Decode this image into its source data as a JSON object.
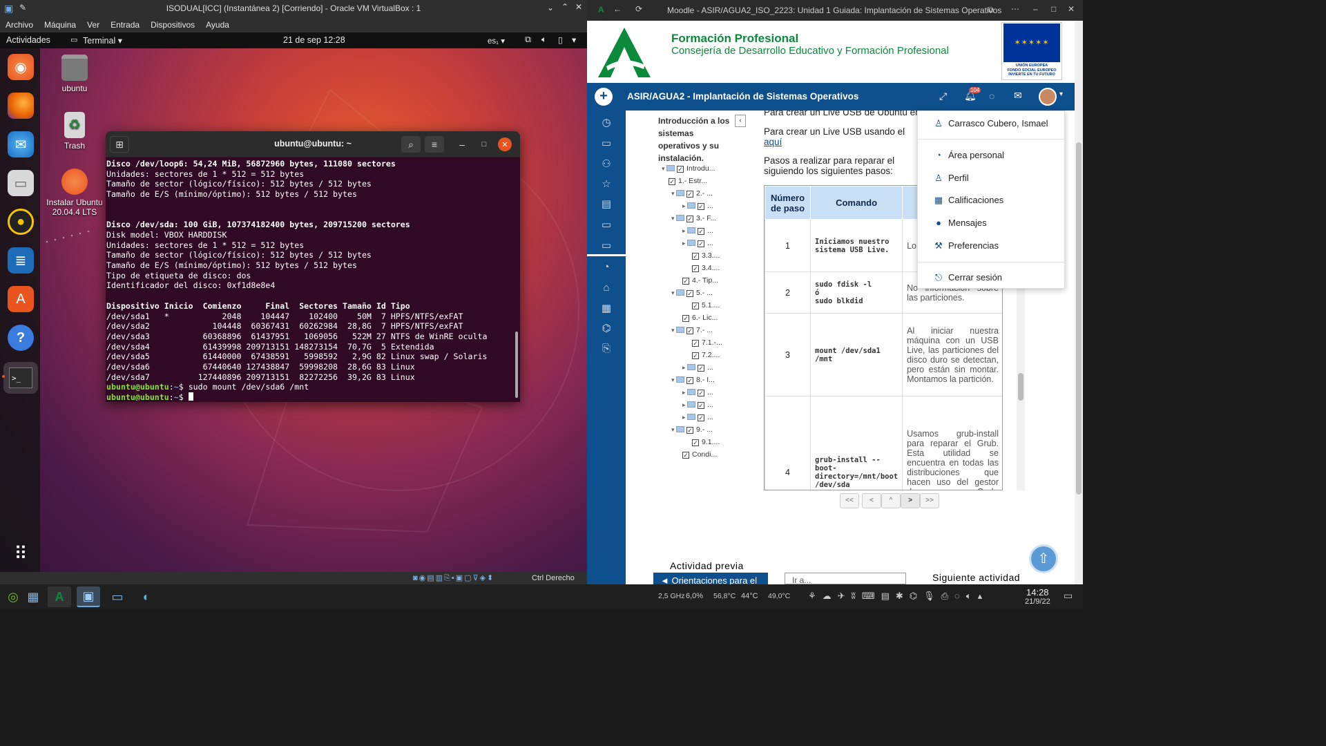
{
  "vbox": {
    "title": "ISODUAL[ICC] (Instantánea 2) [Corriendo] - Oracle VM VirtualBox : 1",
    "menu": [
      "Archivo",
      "Máquina",
      "Ver",
      "Entrada",
      "Dispositivos",
      "Ayuda"
    ],
    "status_key": "Ctrl Derecho"
  },
  "guest": {
    "activities": "Actividades",
    "app_menu": "Terminal ▾",
    "clock": "21 de sep  12:28",
    "keyboard": "es₁ ▾",
    "desktop_icons": [
      {
        "label": "ubuntu"
      },
      {
        "label": "Trash"
      },
      {
        "label": "Instalar Ubuntu 20.04.4 LTS"
      }
    ]
  },
  "terminal": {
    "title": "ubuntu@ubuntu: ~",
    "lines": [
      {
        "t": "Disco /dev/loop6: 54,24 MiB, 56872960 bytes, 111080 sectores",
        "c": "b"
      },
      {
        "t": "Unidades: sectores de 1 * 512 = 512 bytes",
        "c": ""
      },
      {
        "t": "Tamaño de sector (lógico/físico): 512 bytes / 512 bytes",
        "c": ""
      },
      {
        "t": "Tamaño de E/S (mínimo/óptimo): 512 bytes / 512 bytes",
        "c": ""
      },
      {
        "t": "",
        "c": ""
      },
      {
        "t": "",
        "c": ""
      },
      {
        "t": "Disco /dev/sda: 100 GiB, 107374182400 bytes, 209715200 sectores",
        "c": "b"
      },
      {
        "t": "Disk model: VBOX HARDDISK",
        "c": ""
      },
      {
        "t": "Unidades: sectores de 1 * 512 = 512 bytes",
        "c": ""
      },
      {
        "t": "Tamaño de sector (lógico/físico): 512 bytes / 512 bytes",
        "c": ""
      },
      {
        "t": "Tamaño de E/S (mínimo/óptimo): 512 bytes / 512 bytes",
        "c": ""
      },
      {
        "t": "Tipo de etiqueta de disco: dos",
        "c": ""
      },
      {
        "t": "Identificador del disco: 0xf1d8e8e4",
        "c": ""
      },
      {
        "t": "",
        "c": ""
      },
      {
        "t": "Dispositivo Inicio  Comienzo     Final  Sectores Tamaño Id Tipo",
        "c": "b"
      },
      {
        "t": "/dev/sda1   *           2048    104447    102400    50M  7 HPFS/NTFS/exFAT",
        "c": ""
      },
      {
        "t": "/dev/sda2             104448  60367431  60262984  28,8G  7 HPFS/NTFS/exFAT",
        "c": ""
      },
      {
        "t": "/dev/sda3           60368896  61437951   1069056   522M 27 NTFS de WinRE oculta",
        "c": ""
      },
      {
        "t": "/dev/sda4           61439998 209713151 148273154  70,7G  5 Extendida",
        "c": ""
      },
      {
        "t": "/dev/sda5           61440000  67438591   5998592   2,9G 82 Linux swap / Solaris",
        "c": ""
      },
      {
        "t": "/dev/sda6           67440640 127438847  59998208  28,6G 83 Linux",
        "c": ""
      },
      {
        "t": "/dev/sda7          127440896 209713151  82272256  39,2G 83 Linux",
        "c": ""
      }
    ],
    "prompt_user": "ubuntu@ubuntu",
    "prompt_path": "~",
    "command": "sudo mount /dev/sda6 /mnt"
  },
  "browser": {
    "title": "Moodle - ASIR/AGUA2_ISO_2223: Unidad 1 Guiada: Implantación de Sistemas Operativos",
    "header_title": "Formación Profesional",
    "header_subtitle": "Consejería de Desarrollo Educativo y Formación Profesional",
    "eu_text": "UNIÓN EUROPEA\nFONDO SOCIAL EUROPEO\nINVIERTE EN TU FUTURO",
    "course": "ASIR/AGUA2 - Implantación de Sistemas Operativos",
    "notif_count": "104",
    "toc_title": "Introducción a los sistemas operativos y su instalación.",
    "toc_items": [
      "Introdu...",
      "1.- Estr...",
      "2.- ...",
      "...",
      "3.- F...",
      "...",
      "...",
      "3.3....",
      "3.4....",
      "4.- Tip...",
      "5.- ...",
      "5.1....",
      "6.- Lic...",
      "7.- ...",
      "7.1.-...",
      "7.2....",
      "...",
      "8.- I...",
      "...",
      "...",
      "...",
      "9.- ...",
      "9.1....",
      "Condi..."
    ],
    "content_line1": "Para crear un Live USB de Ubuntu en",
    "content_line2": "Para crear un Live USB  usando el",
    "content_link": "aquí",
    "content_line3": "Pasos a realizar para reparar el",
    "content_line4": "siguiendo los siguientes pasos:",
    "table_headers": [
      "Número de paso",
      "Comando",
      ""
    ],
    "table_rows": [
      {
        "n": "1",
        "cmd": "Iniciamos  nuestro sistema USB Live.",
        "desc": "Lo pro ins ter"
      },
      {
        "n": "2",
        "cmd": "sudo fdisk -l\nó\nsudo blkdid",
        "desc": "No información sobre las particiones."
      },
      {
        "n": "3",
        "cmd": "mount   /dev/sda1 /mnt",
        "desc": "Al iniciar nuestra máquina con un USB Live, las particiones del disco duro se detectan, pero están sin montar. Montamos la partición."
      },
      {
        "n": "4",
        "cmd": "grub-install  --boot-directory=/mnt/boot /dev/sda",
        "desc": "Usamos grub-install para reparar el Grub. Esta utilidad se encuentra en todas las distribuciones que hacen uso del gestor de arranque Grub. Vamos a recuperar los archivos"
      }
    ],
    "pager": [
      "<<",
      "<",
      "^",
      ">",
      ">>"
    ],
    "prev_activity": "Actividad previa",
    "prev_button": "◄ Orientaciones para el",
    "goto_select": "Ir a...",
    "next_activity": "Siguiente actividad",
    "dropdown": {
      "user": "Carrasco Cubero, Ismael",
      "items": [
        "Área personal",
        "Perfil",
        "Calificaciones",
        "Mensajes",
        "Preferencias"
      ],
      "logout": "Cerrar sesión"
    }
  },
  "taskbar": {
    "cpu_freq": "2,5 GHz",
    "cpu_load": "6,0%",
    "temp1": "56,8°C",
    "temp2": "44°C",
    "temp3": "49,0°C",
    "time": "14:28",
    "date": "21/9/22"
  },
  "colors": {
    "moodle_blue": "#0e4f8d",
    "junta_green": "#0b8a3c",
    "terminal_bg": "#300a24",
    "prompt_green": "#8ae234"
  }
}
